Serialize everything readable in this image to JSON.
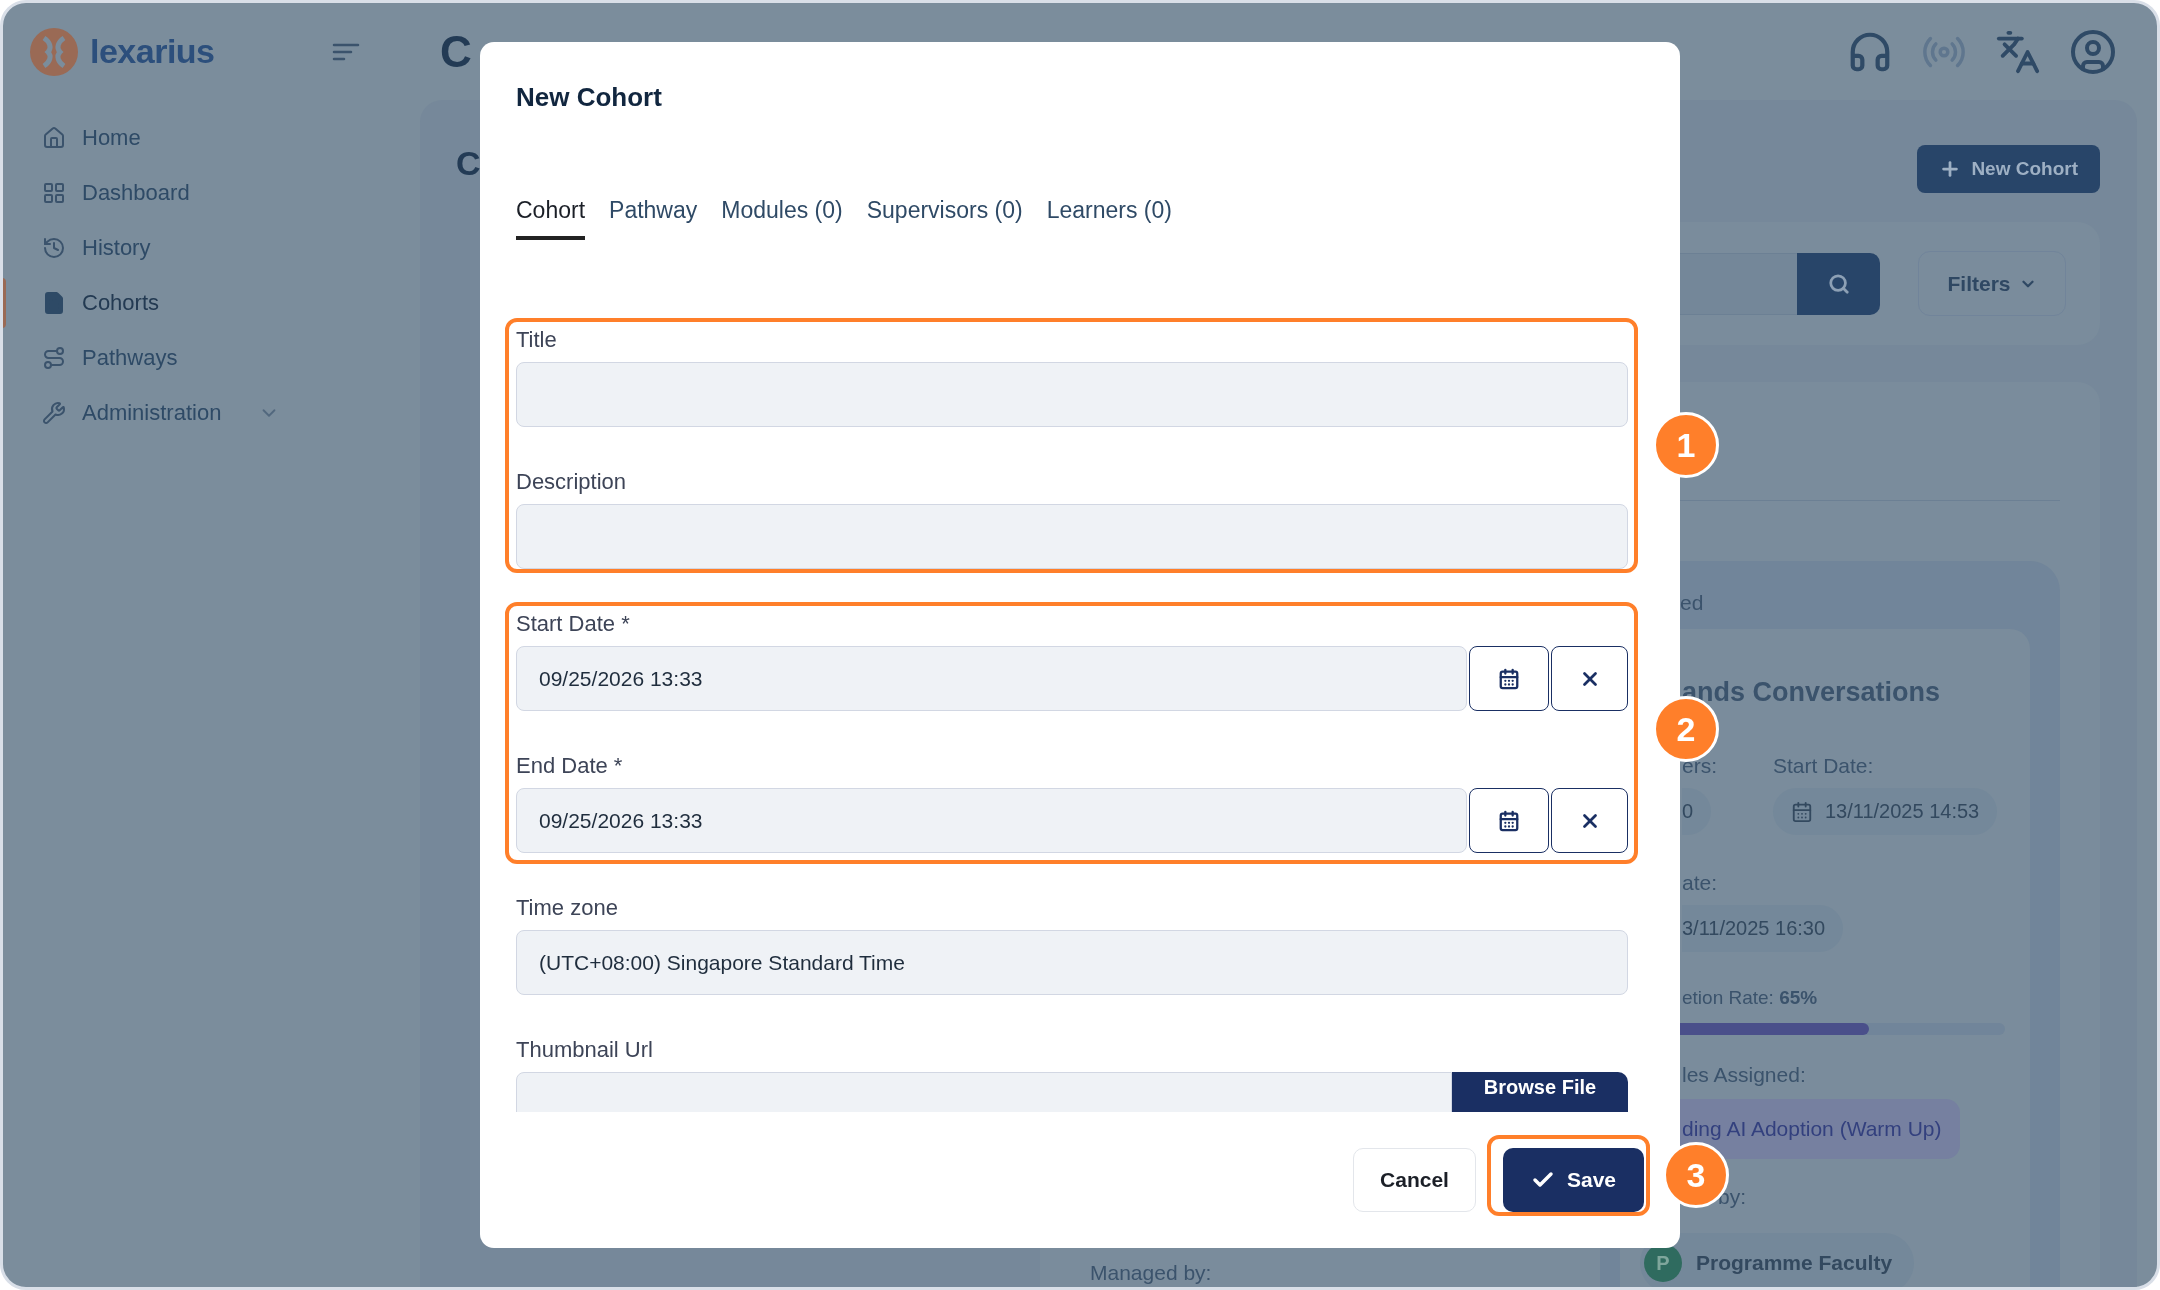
{
  "app": {
    "logo": "lexarius"
  },
  "sidebar": {
    "items": [
      {
        "label": "Home",
        "selected": false
      },
      {
        "label": "Dashboard",
        "selected": false
      },
      {
        "label": "History",
        "selected": false
      },
      {
        "label": "Cohorts",
        "selected": true
      },
      {
        "label": "Pathways",
        "selected": false
      },
      {
        "label": "Administration",
        "selected": false
      }
    ]
  },
  "header": {
    "title": "C"
  },
  "page": {
    "heading": "C",
    "new_button": "New Cohort",
    "filters_button": "Filters",
    "card": {
      "status": "ed",
      "title": "ands Conversations",
      "members_label": "ers:",
      "members_value": "0",
      "start_label": "Start Date:",
      "start_value": "13/11/2025 14:53",
      "end_label": "ate:",
      "end_value": "3/11/2025 16:30",
      "completion": "etion Rate: **65%**",
      "progress": {
        "level": 0.65
      },
      "modules_label": "les Assigned:",
      "module": "ding AI Adoption (Warm Up)",
      "managed_label": "by:",
      "manager_initial": "P",
      "manager": "Programme Faculty"
    },
    "other_card": {
      "managed_label": "Managed by:"
    }
  },
  "modal": {
    "title": "New Cohort",
    "tabs": [
      {
        "label": "Cohort",
        "selected": true
      },
      {
        "label": "Pathway",
        "selected": false
      },
      {
        "label": "Modules (0)",
        "selected": false
      },
      {
        "label": "Supervisors (0)",
        "selected": false
      },
      {
        "label": "Learners (0)",
        "selected": false
      }
    ],
    "fields": [
      {
        "kind": "text",
        "label": "Title"
      },
      {
        "kind": "text",
        "label": "Description"
      },
      {
        "kind": "date",
        "label": "Start Date *",
        "value": "09/25/2026 13:33"
      },
      {
        "kind": "date",
        "label": "End Date *",
        "value": "09/25/2026 13:33"
      },
      {
        "kind": "text",
        "label": "Time zone",
        "value": "(UTC+08:00) Singapore Standard Time"
      },
      {
        "kind": "file",
        "label": "Thumbnail Url",
        "button": "Browse File"
      }
    ],
    "cancel_button": "Cancel",
    "save_button": "Save"
  },
  "annotations": [
    {
      "number": "1"
    },
    {
      "number": "2"
    },
    {
      "number": "3"
    }
  ]
}
